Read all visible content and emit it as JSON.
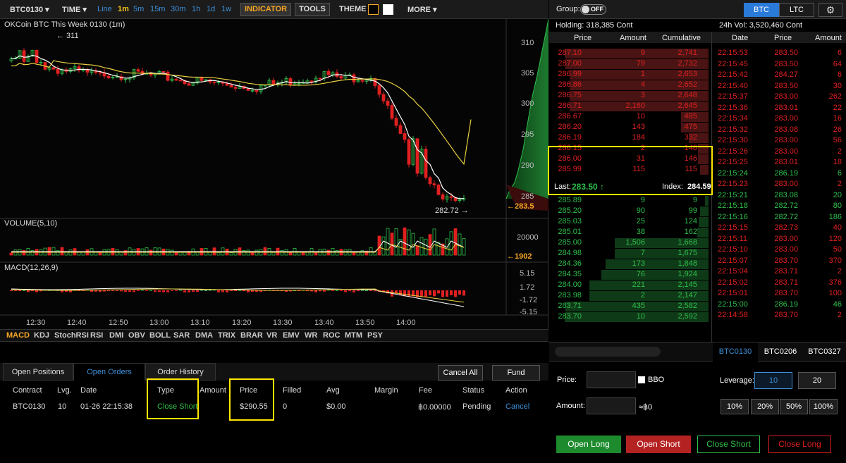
{
  "toolbar": {
    "symbol": "BTC0130 ▾",
    "time": "TIME ▾",
    "intervals": [
      "Line",
      "1m",
      "5m",
      "15m",
      "30m",
      "1h",
      "1d",
      "1w"
    ],
    "indicator": "INDICATOR",
    "tools": "TOOLS",
    "theme": "THEME",
    "more": "MORE ▾"
  },
  "chart": {
    "title": "OKCoin BTC This Week 0130 (1m)",
    "high_marker": "← 311",
    "low_marker": "282.72 →",
    "last_price_marker": "←283.5",
    "price_ticks": [
      "310",
      "305",
      "300",
      "295",
      "290",
      "285"
    ],
    "volume_label": "VOLUME(5,10)",
    "volume_tick": "20000",
    "volume_marker": "←1902",
    "macd_label": "MACD(12,26,9)",
    "macd_ticks": [
      "5.15",
      "1.72",
      "-1.72",
      "-5.15"
    ],
    "time_ticks": [
      "12:30",
      "12:40",
      "12:50",
      "13:00",
      "13:10",
      "13:20",
      "13:30",
      "13:40",
      "13:50",
      "14:00"
    ],
    "colors": {
      "up": "#2fbf4a",
      "down": "#e02020",
      "ma1": "#ffffff",
      "ma2": "#e8d040"
    }
  },
  "indicator_tabs": [
    "MACD",
    "KDJ",
    "StochRSI",
    "RSI",
    "DMI",
    "OBV",
    "BOLL",
    "SAR",
    "DMA",
    "TRIX",
    "BRAR",
    "VR",
    "EMV",
    "WR",
    "ROC",
    "MTM",
    "PSY"
  ],
  "orders": {
    "tabs": [
      "Open Positions",
      "Open Orders",
      "Order History"
    ],
    "cancel_all": "Cancel All",
    "fund": "Fund",
    "headers": [
      "Contract",
      "Lvg.",
      "Date",
      "Type",
      "Amount",
      "Price",
      "Filled",
      "Avg",
      "Margin",
      "Fee",
      "Status",
      "Action"
    ],
    "row": {
      "contract": "BTC0130",
      "lvg": "10",
      "date": "01-26 22:15:38",
      "type": "Close Short",
      "amount": "",
      "price": "$290.55",
      "filled": "0",
      "avg": "$0.00",
      "margin": "",
      "fee": "฿0.00000",
      "status": "Pending",
      "action": "Cancel"
    }
  },
  "right_header": {
    "group": "Group:",
    "toggle": "OFF",
    "tabs": [
      "BTC",
      "LTC"
    ],
    "gear": "gear-icon"
  },
  "orderbook": {
    "holding": "Holding: 318,385 Cont",
    "headers": [
      "Price",
      "Amount",
      "Cumulative"
    ],
    "asks": [
      [
        "287.10",
        "9",
        "2,741"
      ],
      [
        "287.00",
        "79",
        "2,732"
      ],
      [
        "286.99",
        "1",
        "2,653"
      ],
      [
        "286.86",
        "4",
        "2,652"
      ],
      [
        "286.75",
        "3",
        "2,648"
      ],
      [
        "286.71",
        "2,160",
        "2,645"
      ],
      [
        "286.67",
        "10",
        "485"
      ],
      [
        "286.20",
        "143",
        "475"
      ],
      [
        "286.19",
        "184",
        "332"
      ],
      [
        "286.15",
        "2",
        "148"
      ],
      [
        "286.00",
        "31",
        "146"
      ],
      [
        "285.99",
        "115",
        "115"
      ]
    ],
    "last_label": "Last:",
    "last_value": "283.50 ↑",
    "index_label": "Index:",
    "index_value": "284.59",
    "bids": [
      [
        "285.89",
        "9",
        "9"
      ],
      [
        "285.20",
        "90",
        "99"
      ],
      [
        "285.03",
        "25",
        "124"
      ],
      [
        "285.01",
        "38",
        "162"
      ],
      [
        "285.00",
        "1,506",
        "1,668"
      ],
      [
        "284.98",
        "7",
        "1,675"
      ],
      [
        "284.36",
        "173",
        "1,848"
      ],
      [
        "284.35",
        "76",
        "1,924"
      ],
      [
        "284.00",
        "221",
        "2,145"
      ],
      [
        "283.98",
        "2",
        "2,147"
      ],
      [
        "283.71",
        "435",
        "2,582"
      ],
      [
        "283.70",
        "10",
        "2,592"
      ]
    ]
  },
  "trades": {
    "vol": "24h Vol: 3,520,460 Cont",
    "headers": [
      "Date",
      "Price",
      "Amount"
    ],
    "rows": [
      [
        "22:15:53",
        "283.50",
        "6",
        "s"
      ],
      [
        "22:15:45",
        "283.50",
        "64",
        "s"
      ],
      [
        "22:15:42",
        "284.27",
        "6",
        "s"
      ],
      [
        "22:15:40",
        "283.50",
        "30",
        "s"
      ],
      [
        "22:15:37",
        "283.00",
        "262",
        "s"
      ],
      [
        "22:15:36",
        "283.01",
        "22",
        "s"
      ],
      [
        "22:15:34",
        "283.00",
        "16",
        "s"
      ],
      [
        "22:15:32",
        "283.08",
        "26",
        "s"
      ],
      [
        "22:15:30",
        "283.00",
        "56",
        "s"
      ],
      [
        "22:15:26",
        "283.00",
        "2",
        "s"
      ],
      [
        "22:15:25",
        "283.01",
        "18",
        "s"
      ],
      [
        "22:15:24",
        "286.19",
        "6",
        "b"
      ],
      [
        "22:15:23",
        "283.00",
        "2",
        "s"
      ],
      [
        "22:15:21",
        "283.08",
        "20",
        "b"
      ],
      [
        "22:15:18",
        "282.72",
        "80",
        "b"
      ],
      [
        "22:15:16",
        "282.72",
        "186",
        "b"
      ],
      [
        "22:15:15",
        "282.73",
        "40",
        "s"
      ],
      [
        "22:15:11",
        "283.00",
        "120",
        "s"
      ],
      [
        "22:15:10",
        "283.00",
        "50",
        "s"
      ],
      [
        "22:15:07",
        "283.70",
        "370",
        "s"
      ],
      [
        "22:15:04",
        "283.71",
        "2",
        "s"
      ],
      [
        "22:15:02",
        "283.71",
        "376",
        "s"
      ],
      [
        "22:15:01",
        "283.70",
        "100",
        "s"
      ],
      [
        "22:15:00",
        "286.19",
        "46",
        "b"
      ],
      [
        "22:14:58",
        "283.70",
        "2",
        "s"
      ]
    ]
  },
  "contract_tabs": [
    "BTC0130",
    "BTC0206",
    "BTC0327"
  ],
  "trade_form": {
    "price_label": "Price:",
    "bbo": "BBO",
    "amount_label": "Amount:",
    "approx": "≈฿0",
    "leverage_label": "Leverage:",
    "lev_options": [
      "10",
      "20"
    ],
    "pct_buttons": [
      "10%",
      "20%",
      "50%",
      "100%"
    ],
    "open_long": "Open Long",
    "open_short": "Open Short",
    "close_short": "Close Short",
    "close_long": "Close Long"
  }
}
